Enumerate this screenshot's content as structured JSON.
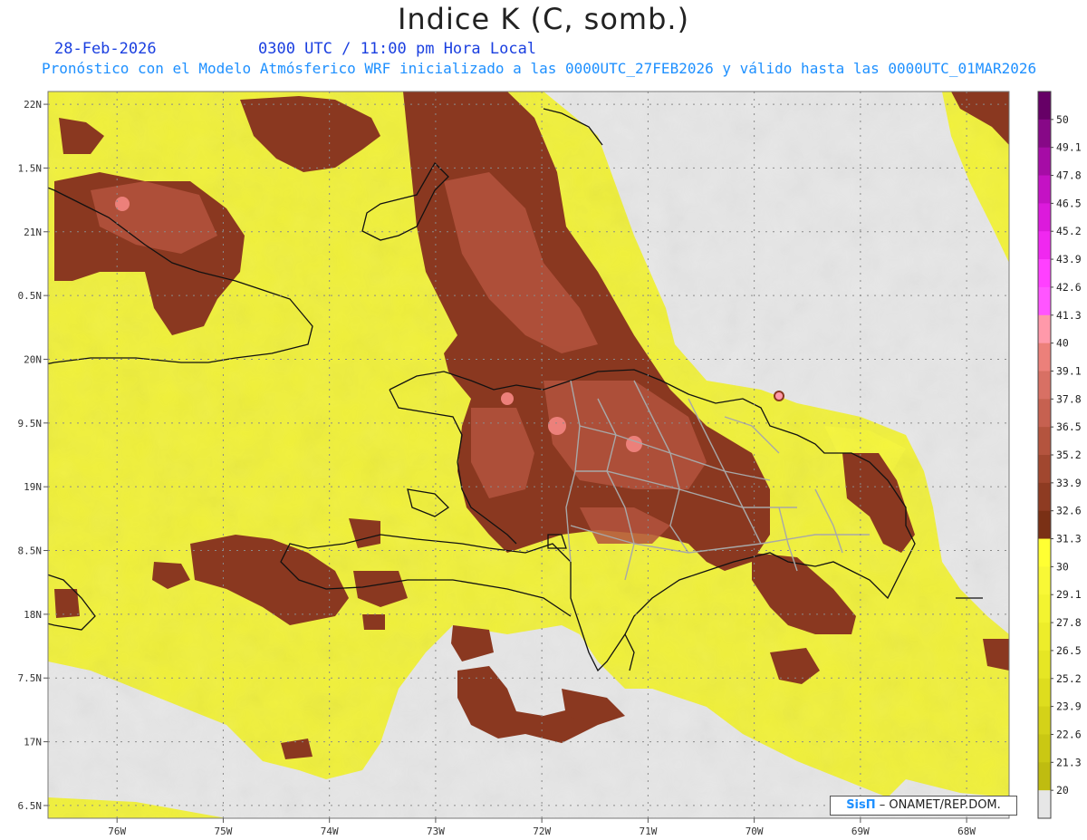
{
  "header": {
    "title": "Indice K (C, somb.)",
    "date": "28-Feb-2026",
    "time": "0300 UTC / 11:00 pm Hora Local",
    "subtitle": "Pronóstico con el Modelo Atmósferico WRF inicializado a las 0000UTC_27FEB2026 y válido hasta las  0000UTC_01MAR2026"
  },
  "credit": {
    "brand": "SisΠ",
    "text": "– ONAMET/REP.DOM."
  },
  "colors": {
    "background": "#e6e6e6",
    "coast": "#111111",
    "provinces": "#a8a8a8",
    "grid": "#9a9a9a"
  },
  "chart_data": {
    "type": "heatmap",
    "title": "Indice K (C, somb.)",
    "x_ticks": [
      "76W",
      "75W",
      "74W",
      "73W",
      "72W",
      "71W",
      "70W",
      "69W",
      "68W"
    ],
    "x_values": [
      -76,
      -75,
      -74,
      -73,
      -72,
      -71,
      -70,
      -69,
      -68
    ],
    "y_ticks": [
      "22N",
      "1.5N",
      "21N",
      "0.5N",
      "20N",
      "9.5N",
      "19N",
      "8.5N",
      "18N",
      "7.5N",
      "17N",
      "6.5N"
    ],
    "y_values": [
      22,
      21.5,
      21,
      20.5,
      20,
      19.5,
      19,
      18.5,
      18,
      17.5,
      17,
      16.5
    ],
    "xlim": [
      -76.65,
      -67.6
    ],
    "ylim": [
      16.4,
      22.1
    ],
    "grid": true,
    "legend_placement": "right",
    "colorbar": {
      "levels": [
        "20",
        "21.3",
        "22.6",
        "23.9",
        "25.2",
        "26.5",
        "27.8",
        "29.1",
        "30",
        "31.3",
        "32.6",
        "33.9",
        "35.2",
        "36.5",
        "37.8",
        "39.1",
        "40",
        "41.3",
        "42.6",
        "43.9",
        "45.2",
        "46.5",
        "47.8",
        "49.1",
        "50"
      ],
      "colors": [
        "#bfbc10",
        "#cac813",
        "#d4d218",
        "#dedd1e",
        "#e6e624",
        "#eded2a",
        "#f3f430",
        "#f8f836",
        "#ffff33",
        "#7a3015",
        "#8e3b22",
        "#a1472f",
        "#b4543e",
        "#c66150",
        "#d87064",
        "#ec807a",
        "#ff99aa",
        "#ff55ff",
        "#ff40ff",
        "#f028f0",
        "#dc1adc",
        "#c412c4",
        "#a60ca6",
        "#870887",
        "#660066"
      ]
    }
  }
}
